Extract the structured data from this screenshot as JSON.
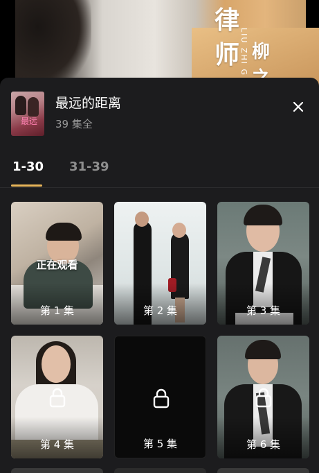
{
  "video": {
    "overlay_chars": [
      "律",
      "师",
      "柳",
      "之"
    ],
    "overlay_pinyin": "LIU ZHI G"
  },
  "sheet": {
    "title": "最远的距离",
    "subtitle": "39 集全",
    "poster_text": "最远"
  },
  "tabs": [
    {
      "label": "1-30",
      "active": true
    },
    {
      "label": "31-39",
      "active": false
    }
  ],
  "episodes": [
    {
      "label": "第 1 集",
      "status": "正在观看",
      "locked": false
    },
    {
      "label": "第 2 集",
      "locked": false
    },
    {
      "label": "第 3 集",
      "locked": false
    },
    {
      "label": "第 4 集",
      "locked": true
    },
    {
      "label": "第 5 集",
      "locked": true
    },
    {
      "label": "第 6 集",
      "locked": true
    }
  ],
  "colors": {
    "accent": "#e8b65a",
    "sheet_bg": "#1c1c1e",
    "muted_text": "#9a9a9a"
  },
  "icons": {
    "close": "close-icon",
    "lock": "lock-icon"
  }
}
